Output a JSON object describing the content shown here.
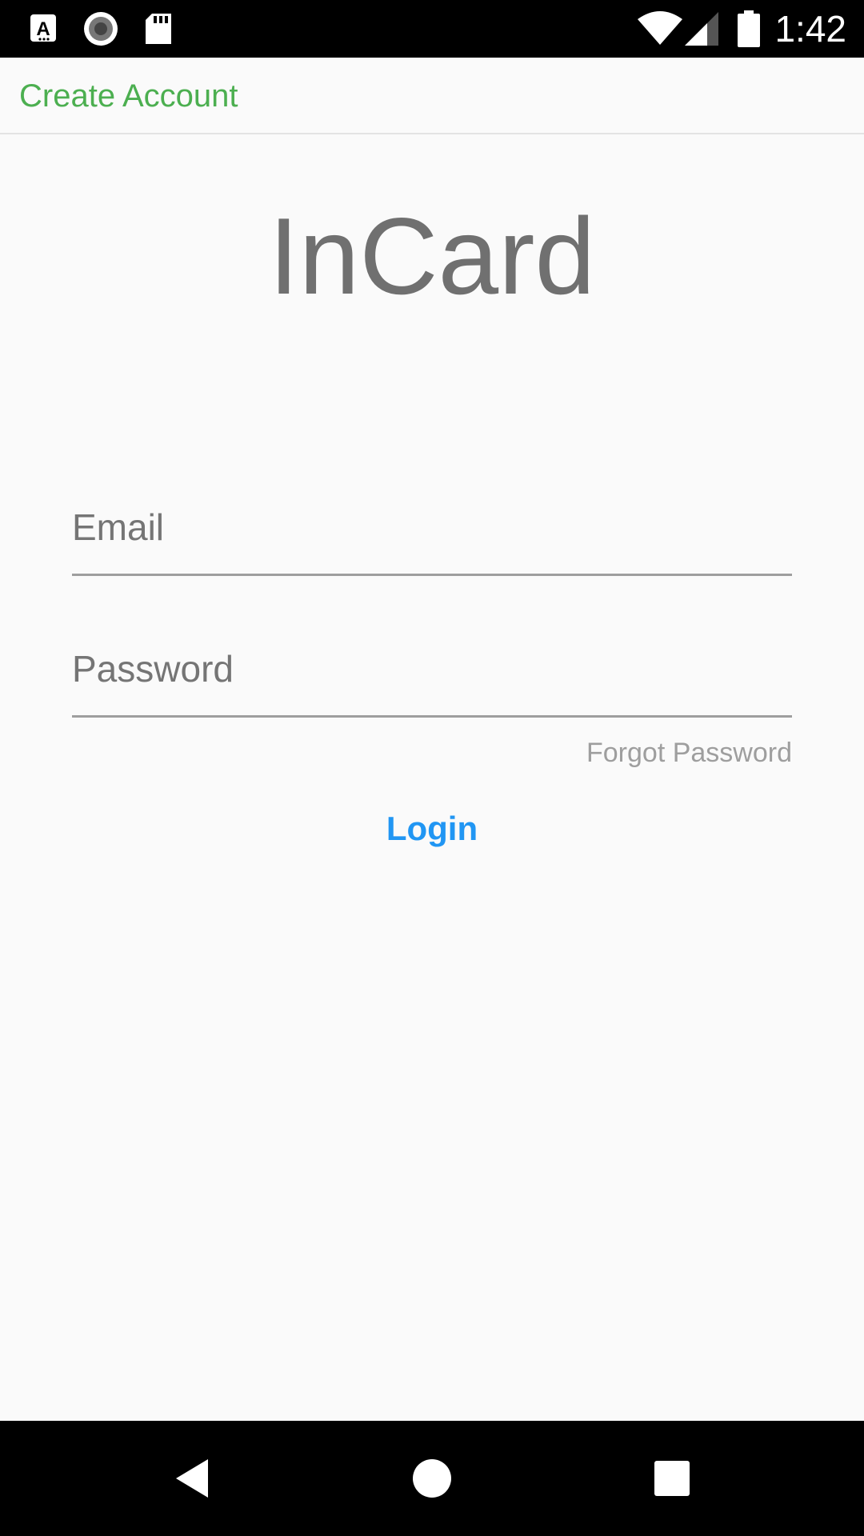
{
  "status_bar": {
    "time": "1:42",
    "icons": [
      "a11y-font-icon",
      "record-icon",
      "sd-card-icon",
      "wifi-icon",
      "cell-signal-icon",
      "battery-icon"
    ]
  },
  "app_bar": {
    "create_account_label": "Create Account"
  },
  "main": {
    "app_title": "InCard",
    "email": {
      "placeholder": "Email",
      "value": ""
    },
    "password": {
      "placeholder": "Password",
      "value": ""
    },
    "forgot_password_label": "Forgot Password",
    "login_label": "Login"
  },
  "nav_bar": {
    "buttons": [
      "back-icon",
      "home-icon",
      "recents-icon"
    ]
  },
  "colors": {
    "accent_green": "#4caf50",
    "accent_blue": "#2196f3",
    "title_gray": "#707070",
    "background": "#fafafa"
  }
}
